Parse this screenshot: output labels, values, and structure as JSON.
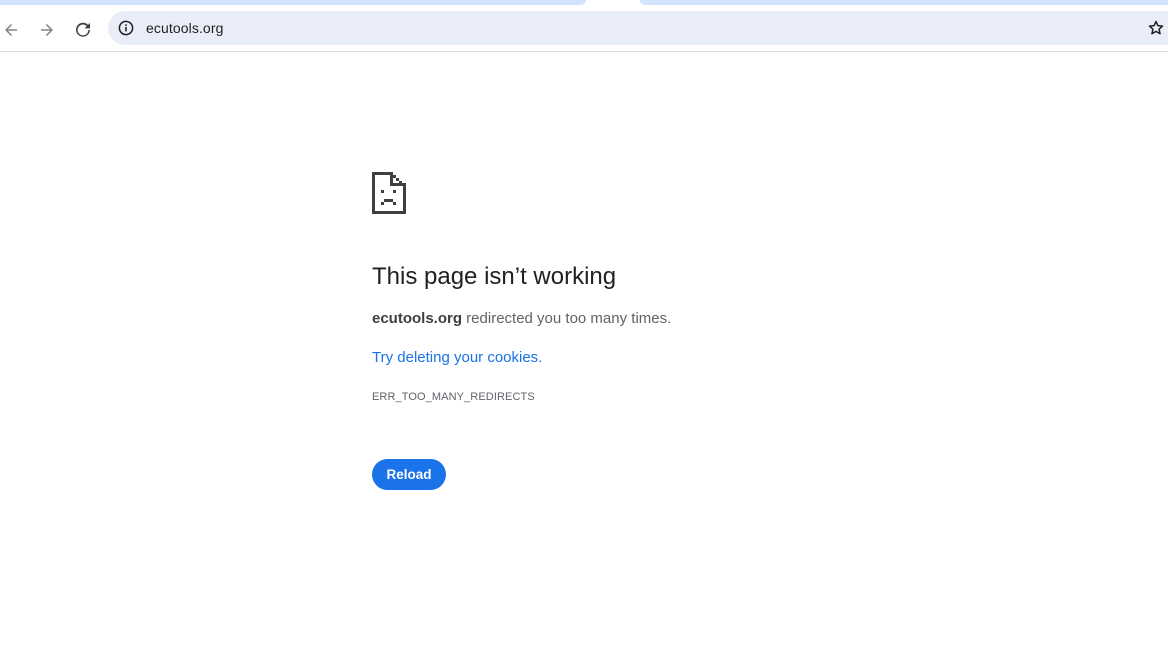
{
  "browser": {
    "url": "ecutools.org",
    "icons": {
      "back": "arrow-left-icon",
      "forward": "arrow-right-icon",
      "reload": "reload-icon",
      "site_info": "info-circle-icon",
      "bookmark": "star-outline-icon"
    }
  },
  "error": {
    "icon": "sad-page-icon",
    "title": "This page isn’t working",
    "domain": "ecutools.org",
    "description_suffix": " redirected you too many times.",
    "suggestion_link": "Try deleting your cookies",
    "suggestion_period": ".",
    "code": "ERR_TOO_MANY_REDIRECTS",
    "reload_label": "Reload"
  },
  "colors": {
    "accent": "#1a73e8",
    "omnibox_bg": "#e9edf7",
    "tab_strip": "#d3e3fd"
  }
}
